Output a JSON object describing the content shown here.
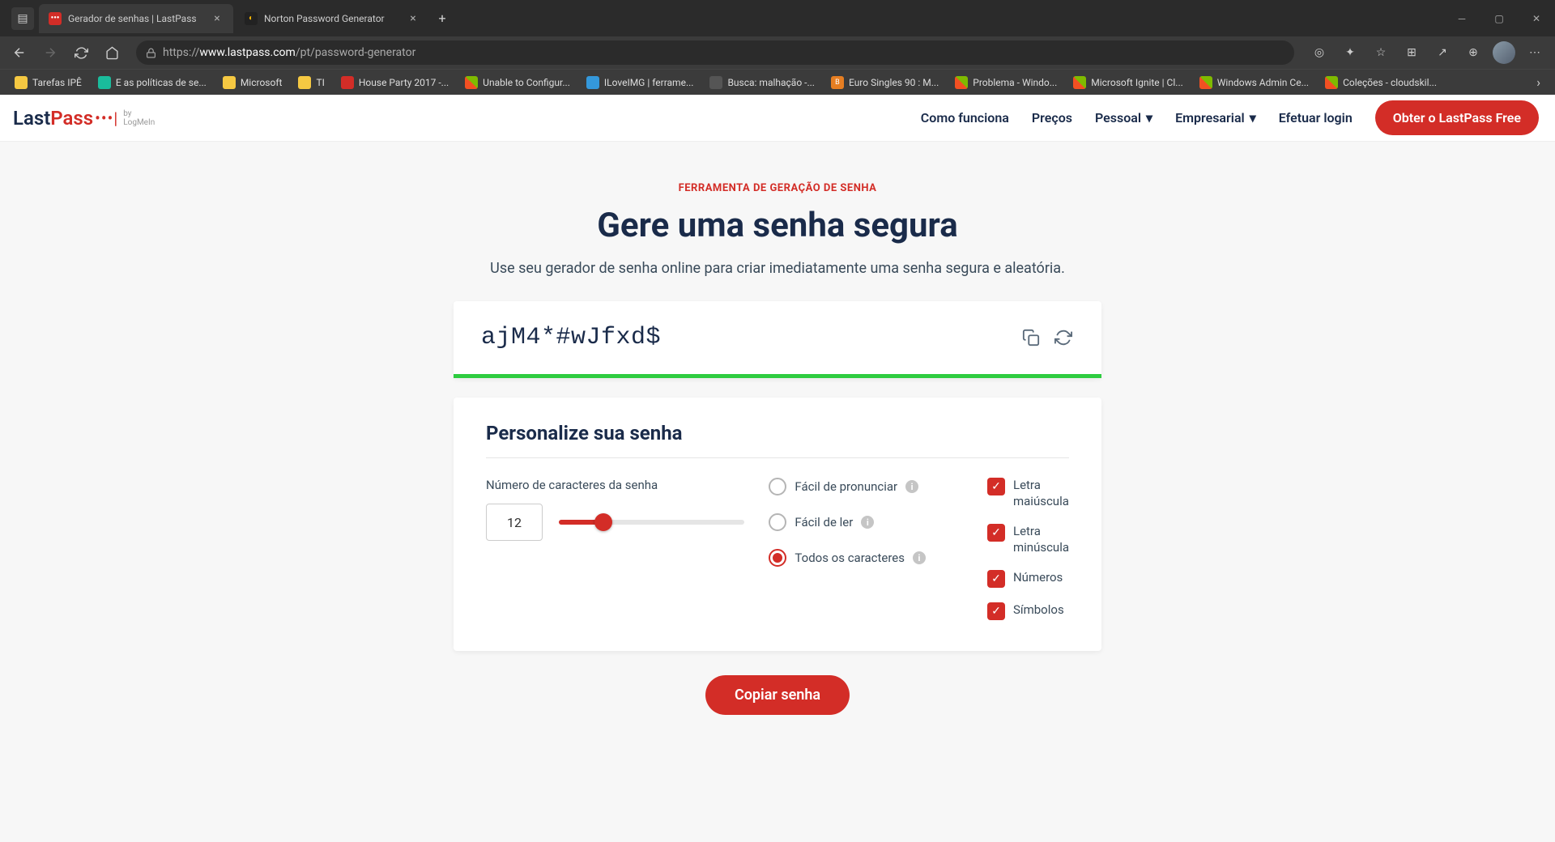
{
  "browser": {
    "tabs": [
      {
        "title": "Gerador de senhas | LastPass",
        "active": true,
        "favicon": "lastpass"
      },
      {
        "title": "Norton Password Generator",
        "active": false,
        "favicon": "norton"
      }
    ],
    "url_prefix": "https://",
    "url_domain": "www.lastpass.com",
    "url_path": "/pt/password-generator",
    "bookmarks": [
      {
        "label": "Tarefas IPÊ",
        "type": "folder"
      },
      {
        "label": "E as políticas de se...",
        "type": "teal"
      },
      {
        "label": "Microsoft",
        "type": "folder"
      },
      {
        "label": "TI",
        "type": "folder"
      },
      {
        "label": "House Party 2017 -...",
        "type": "os"
      },
      {
        "label": "Unable to Configur...",
        "type": "ms"
      },
      {
        "label": "ILoveIMG | ferrame...",
        "type": "blue"
      },
      {
        "label": "Busca: malhação -...",
        "type": "gray"
      },
      {
        "label": "Euro Singles 90 : M...",
        "type": "orange"
      },
      {
        "label": "Problema - Windo...",
        "type": "ms"
      },
      {
        "label": "Microsoft Ignite | Cl...",
        "type": "ms"
      },
      {
        "label": "Windows Admin Ce...",
        "type": "ms"
      },
      {
        "label": "Coleções - cloudskil...",
        "type": "ms"
      }
    ]
  },
  "nav": {
    "items": [
      "Como funciona",
      "Preços",
      "Pessoal",
      "Empresarial",
      "Efetuar login"
    ],
    "cta": "Obter o LastPass Free"
  },
  "hero": {
    "eyebrow": "FERRAMENTA DE GERAÇÃO DE SENHA",
    "heading": "Gere uma senha segura",
    "subheading": "Use seu gerador de senha online para criar imediatamente uma senha segura e aleatória."
  },
  "password": {
    "value": "ajM4*#wJfxd$"
  },
  "options": {
    "title": "Personalize sua senha",
    "length_label": "Número de caracteres da senha",
    "length_value": "12",
    "radios": [
      {
        "label": "Fácil de pronunciar",
        "checked": false
      },
      {
        "label": "Fácil de ler",
        "checked": false
      },
      {
        "label": "Todos os caracteres",
        "checked": true
      }
    ],
    "checks": [
      {
        "label": "Letra maiúscula",
        "checked": true
      },
      {
        "label": "Letra minúscula",
        "checked": true
      },
      {
        "label": "Números",
        "checked": true
      },
      {
        "label": "Símbolos",
        "checked": true
      }
    ]
  },
  "copy_button": "Copiar senha"
}
